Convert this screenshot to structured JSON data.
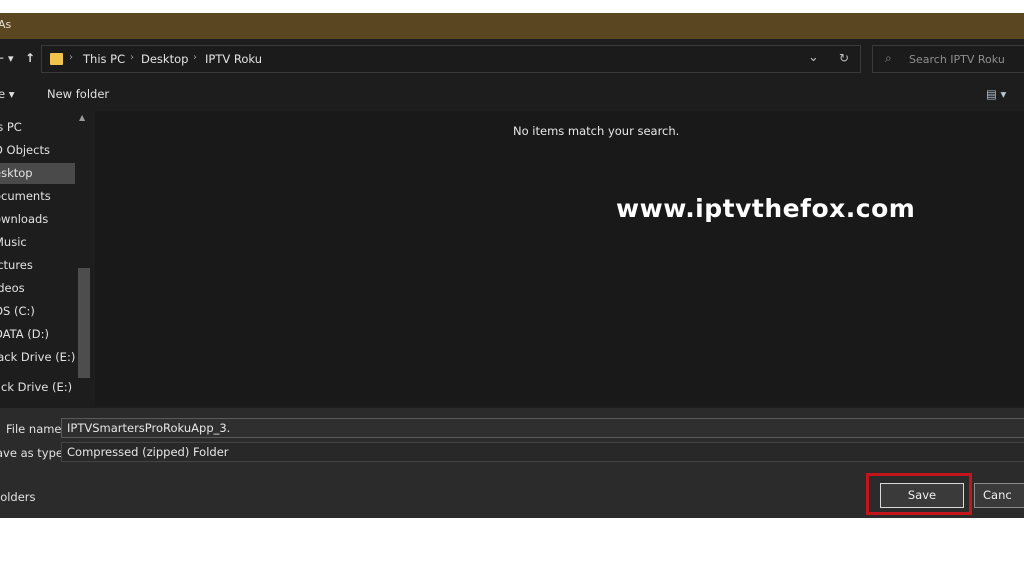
{
  "window": {
    "title": "As"
  },
  "nav": {
    "back": "←",
    "dropdown": "▾",
    "up": "↑"
  },
  "address": {
    "crumbs": [
      "This PC",
      "Desktop",
      "IPTV Roku"
    ],
    "separator": "›",
    "dropdown": "⌄",
    "refresh": "↻"
  },
  "search": {
    "icon": "⌕",
    "placeholder": "Search IPTV Roku"
  },
  "toolbar": {
    "organize": "e ▾",
    "new_folder": "New folder",
    "view": "▤ ▾"
  },
  "sidebar": {
    "items": [
      {
        "label": "is PC"
      },
      {
        "label": "D Objects"
      },
      {
        "label": "esktop",
        "selected": true
      },
      {
        "label": "ocuments"
      },
      {
        "label": "ownloads"
      },
      {
        "label": "Music"
      },
      {
        "label": "ictures"
      },
      {
        "label": "ideos"
      },
      {
        "label": "OS (C:)"
      },
      {
        "label": "DATA (D:)"
      },
      {
        "label": "lack Drive (E:)"
      },
      {
        "label": "ack Drive (E:)"
      }
    ]
  },
  "content": {
    "empty_message": "No items match your search."
  },
  "watermark": "www.iptvthefox.com",
  "form": {
    "file_name_label": "File name:",
    "file_name_value": "IPTVSmartersProRokuApp_3.",
    "save_type_label": "ave as type:",
    "save_type_value": "Compressed (zipped) Folder"
  },
  "footer": {
    "folders_toggle": "Folders",
    "save_label": "Save",
    "cancel_label": "Canc"
  },
  "colors": {
    "titlebar": "#5b4622",
    "highlight": "#c4151c",
    "folder": "#f0c44c"
  }
}
